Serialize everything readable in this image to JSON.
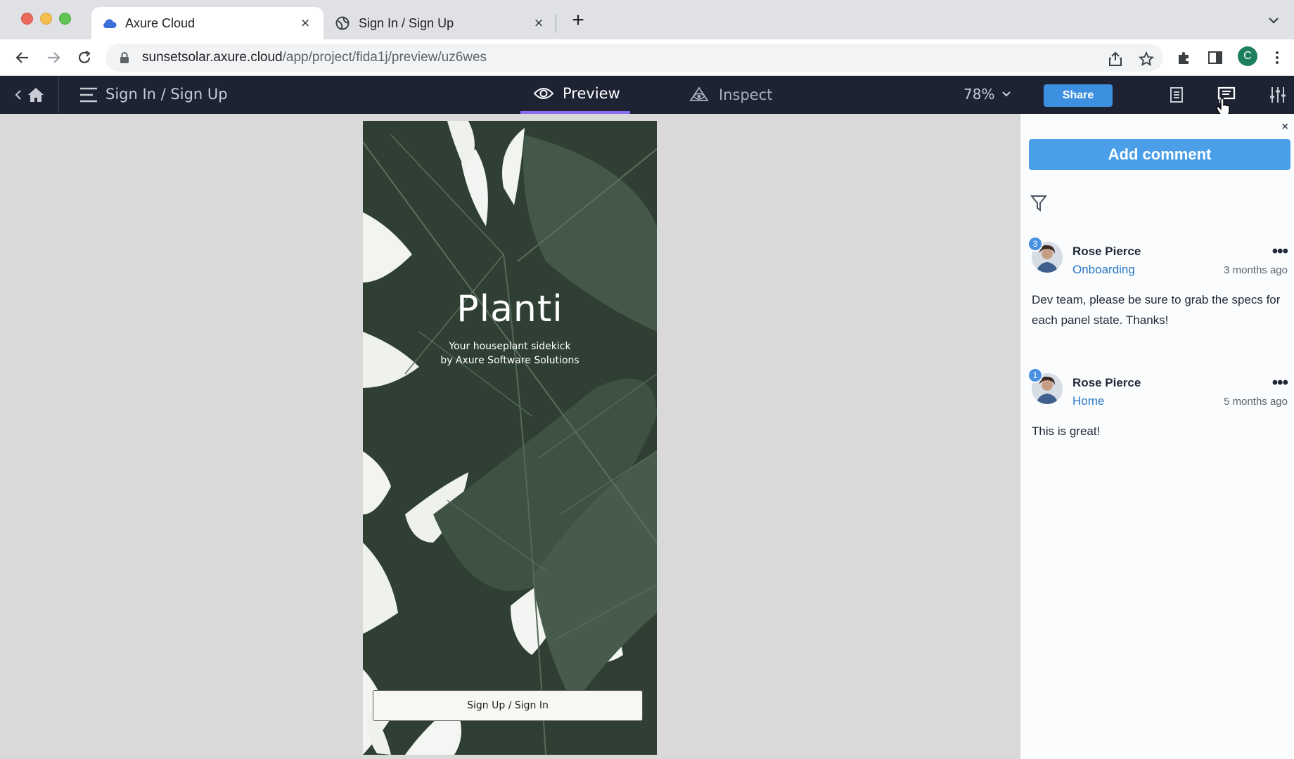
{
  "browser": {
    "tabs": [
      {
        "title": "Axure Cloud",
        "icon": "cloud-icon",
        "active": true
      },
      {
        "title": "Sign In / Sign Up",
        "icon": "globe-icon",
        "active": false
      }
    ],
    "url_host": "sunsetsolar.axure.cloud",
    "url_path": "/app/project/fida1j/preview/uz6wes",
    "profile_initial": "C",
    "colors": {
      "tabbar": "#dfe1e5",
      "profile": "#1e7f5c"
    }
  },
  "header": {
    "page_name": "Sign In / Sign Up",
    "tabs": {
      "preview": "Preview",
      "inspect": "Inspect"
    },
    "zoom": "78%",
    "share_label": "Share",
    "colors": {
      "background": "#1d2333",
      "share": "#3d8fe0",
      "active_tab": "#8a6cf0"
    }
  },
  "prototype": {
    "brand": "Planti",
    "tagline_line1": "Your houseplant sidekick",
    "tagline_line2": "by Axure Software Solutions",
    "cta_label": "Sign Up / Sign In"
  },
  "comments_panel": {
    "add_label": "Add comment",
    "close_label": "×",
    "comments": [
      {
        "badge": "3",
        "author": "Rose Pierce",
        "page": "Onboarding",
        "time": "3 months ago",
        "text": "Dev team, please be sure to grab the specs for each panel state. Thanks!"
      },
      {
        "badge": "1",
        "author": "Rose Pierce",
        "page": "Home",
        "time": "5 months ago",
        "text": "This is great!"
      }
    ],
    "colors": {
      "add_button": "#4a9fe8",
      "link": "#2a76c6",
      "badge": "#4a90e2"
    }
  }
}
